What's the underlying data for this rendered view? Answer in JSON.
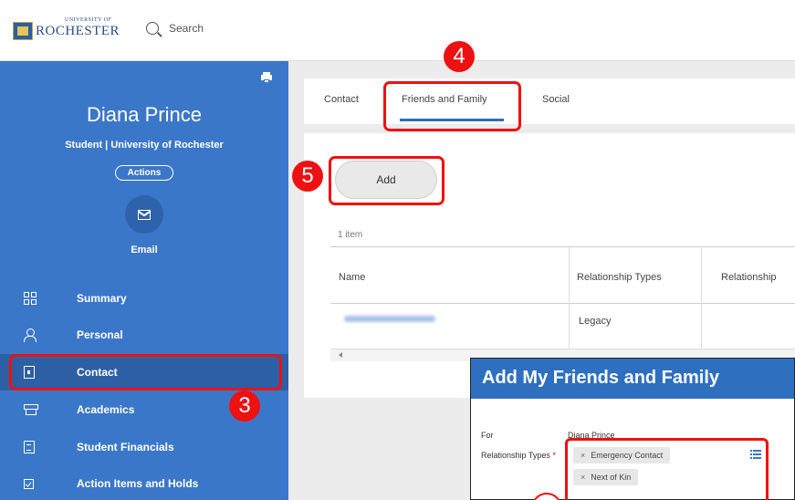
{
  "header": {
    "logo_small": "UNIVERSITY OF",
    "logo_main": "ROCHESTER",
    "search_label": "Search"
  },
  "sidebar": {
    "name": "Diana Prince",
    "subtitle": "Student | University of Rochester",
    "actions_label": "Actions",
    "email_label": "Email",
    "items": [
      {
        "label": "Summary",
        "icon": "summary-icon"
      },
      {
        "label": "Personal",
        "icon": "person-icon"
      },
      {
        "label": "Contact",
        "icon": "contact-icon",
        "active": true
      },
      {
        "label": "Academics",
        "icon": "academics-icon"
      },
      {
        "label": "Student Financials",
        "icon": "financials-icon"
      },
      {
        "label": "Action Items and Holds",
        "icon": "action-items-icon"
      }
    ]
  },
  "tabs": [
    {
      "label": "Contact"
    },
    {
      "label": "Friends and Family",
      "active": true
    },
    {
      "label": "Social"
    }
  ],
  "content": {
    "add_label": "Add",
    "item_count": "1 item",
    "columns": [
      "Name",
      "Relationship Types",
      "Relationship"
    ],
    "rows": [
      {
        "relationship_types": "Legacy"
      }
    ]
  },
  "popup": {
    "title": "Add My Friends and Family",
    "for_label": "For",
    "for_value": "Diana Prince",
    "relationship_label": "Relationship Types",
    "required_mark": "*",
    "chips": [
      "Emergency Contact",
      "Next of Kin"
    ]
  },
  "annotations": {
    "step3": "3",
    "step4": "4",
    "step5": "5"
  },
  "colors": {
    "sidebar_bg": "#3b77c8",
    "active_item": "#2d5fa5",
    "annotation_red": "#e11111",
    "popup_header": "#2e6fc0"
  }
}
